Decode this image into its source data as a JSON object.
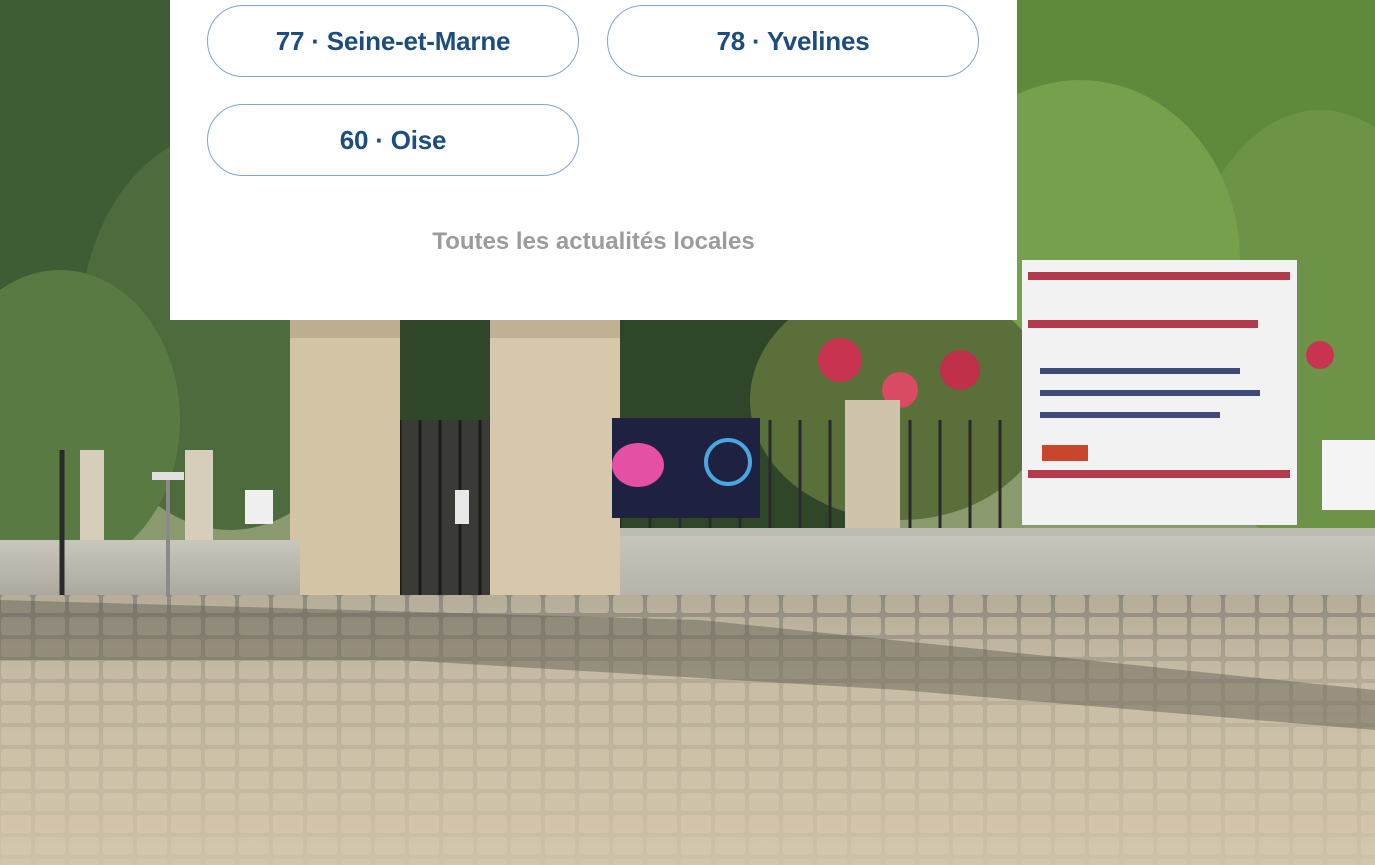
{
  "departments": [
    {
      "label": "77 · Seine-et-Marne"
    },
    {
      "label": "78 · Yvelines"
    },
    {
      "label": "60 · Oise"
    }
  ],
  "all_local_news_label": "Toutes les actualités locales",
  "colors": {
    "button_text": "#1c4d7e",
    "button_border": "#7fa6cf",
    "link_text": "#9c9c9c",
    "panel_bg": "#ffffff"
  }
}
